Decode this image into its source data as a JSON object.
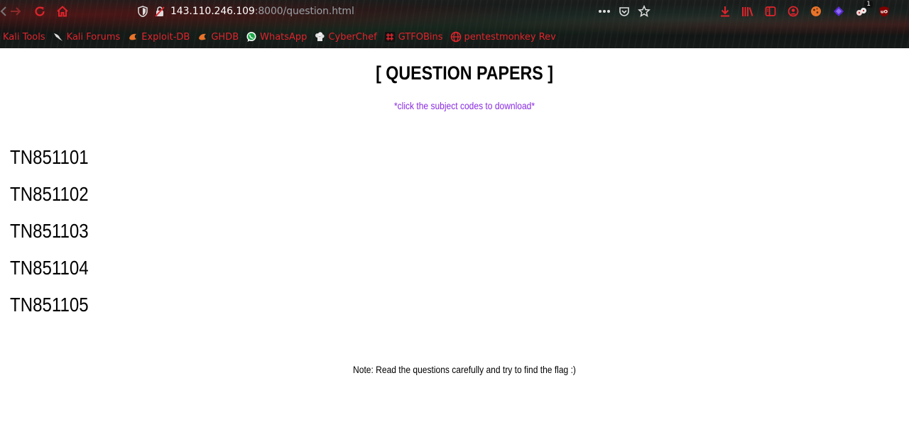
{
  "browser": {
    "url_host": "143.110.246.109",
    "url_path": ":8000/question.html",
    "extension_badge": "1",
    "bookmarks": [
      {
        "label": "Kali Tools",
        "icon": "kali-icon"
      },
      {
        "label": "Kali Forums",
        "icon": "kali-dragon-icon"
      },
      {
        "label": "Exploit-DB",
        "icon": "exploit-db-icon"
      },
      {
        "label": "GHDB",
        "icon": "ghdb-icon"
      },
      {
        "label": "WhatsApp",
        "icon": "whatsapp-icon"
      },
      {
        "label": "CyberChef",
        "icon": "cyberchef-icon"
      },
      {
        "label": "GTFOBins",
        "icon": "gtfobins-icon"
      },
      {
        "label": "pentestmonkey Rev",
        "icon": "globe-icon"
      }
    ]
  },
  "page": {
    "title": "[ QUESTION PAPERS ]",
    "hint": "*click the subject codes to download*",
    "subject_codes": [
      "TN851101",
      "TN851102",
      "TN851103",
      "TN851104",
      "TN851105"
    ],
    "note": "Note: Read the questions carefully and try to find the flag :)"
  },
  "colors": {
    "accent_red": "#e0242c",
    "hint_purple": "#8a2be2"
  }
}
